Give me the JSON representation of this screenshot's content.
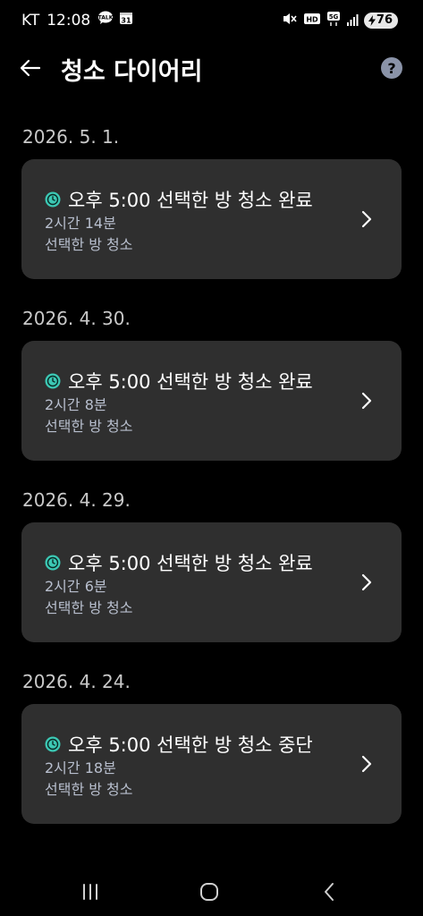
{
  "status_bar": {
    "carrier": "KT",
    "time": "12:08",
    "left_icons": [
      "talk-icon",
      "calendar-icon"
    ],
    "calendar_day": "31",
    "right_icons": [
      "mute-icon",
      "hd-icon",
      "5g-icon",
      "signal-icon"
    ],
    "network_label": "5G",
    "hd_label": "HD",
    "battery": "76"
  },
  "header": {
    "title": "청소 다이어리",
    "back_icon": "arrow-left-icon",
    "help_icon": "question-icon",
    "help_label": "?"
  },
  "groups": [
    {
      "date": "2026. 5. 1.",
      "entry": {
        "title": "오후 5:00 선택한 방 청소 완료",
        "duration": "2시간 14분",
        "area": "선택한 방 청소"
      }
    },
    {
      "date": "2026. 4. 30.",
      "entry": {
        "title": "오후 5:00 선택한 방 청소 완료",
        "duration": "2시간 8분",
        "area": "선택한 방 청소"
      }
    },
    {
      "date": "2026. 4. 29.",
      "entry": {
        "title": "오후 5:00 선택한 방 청소 완료",
        "duration": "2시간 6분",
        "area": "선택한 방 청소"
      }
    },
    {
      "date": "2026. 4. 24.",
      "entry": {
        "title": "오후 5:00 선택한 방 청소 중단",
        "duration": "2시간 18분",
        "area": "선택한 방 청소"
      }
    }
  ],
  "nav_bar": {
    "icons": [
      "recents-icon",
      "home-icon",
      "back-icon"
    ]
  },
  "colors": {
    "background": "#000000",
    "card": "#2f2f2f",
    "accent_teal": "#3cc8b4",
    "secondary_text": "#b8bfce",
    "date_text": "#c9c9c9"
  }
}
